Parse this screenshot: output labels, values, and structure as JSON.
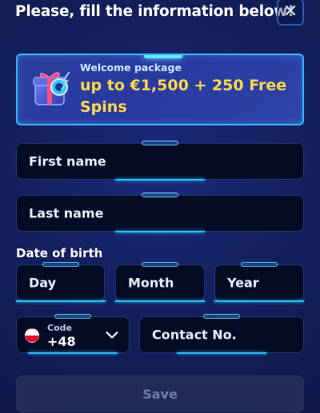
{
  "header": {
    "title": "Please, fill the information below!",
    "close_icon": "close-icon"
  },
  "promo": {
    "kicker": "Welcome package",
    "offer": "up to €1,500 + 250 Free Spins",
    "gift_icon": "gift-icon"
  },
  "form": {
    "first_name_placeholder": "First name",
    "last_name_placeholder": "Last name",
    "dob_title": "Date of birth",
    "day_placeholder": "Day",
    "month_placeholder": "Month",
    "year_placeholder": "Year",
    "phone": {
      "code_label": "Code",
      "code_value": "+48",
      "flag_icon": "poland-flag-icon",
      "chevron_icon": "chevron-down-icon",
      "contact_placeholder": "Contact No."
    },
    "save_label": "Save"
  },
  "colors": {
    "background": "#14205f",
    "field_bg": "#040b24",
    "accent": "#37b7ff",
    "highlight": "#ffd84d",
    "disabled_button": "#222c59"
  }
}
